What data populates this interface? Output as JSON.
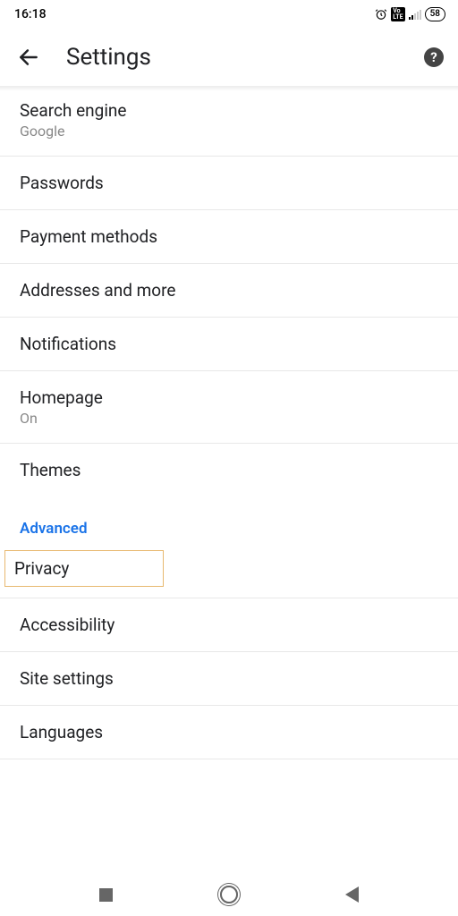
{
  "status": {
    "time": "16:18",
    "battery": "58"
  },
  "header": {
    "title": "Settings"
  },
  "sectionHeader": "Advanced",
  "items": {
    "searchEngine": {
      "title": "Search engine",
      "sub": "Google"
    },
    "passwords": {
      "title": "Passwords"
    },
    "paymentMethods": {
      "title": "Payment methods"
    },
    "addresses": {
      "title": "Addresses and more"
    },
    "notifications": {
      "title": "Notifications"
    },
    "homepage": {
      "title": "Homepage",
      "sub": "On"
    },
    "themes": {
      "title": "Themes"
    },
    "privacy": {
      "title": "Privacy"
    },
    "accessibility": {
      "title": "Accessibility"
    },
    "siteSettings": {
      "title": "Site settings"
    },
    "languages": {
      "title": "Languages"
    }
  }
}
